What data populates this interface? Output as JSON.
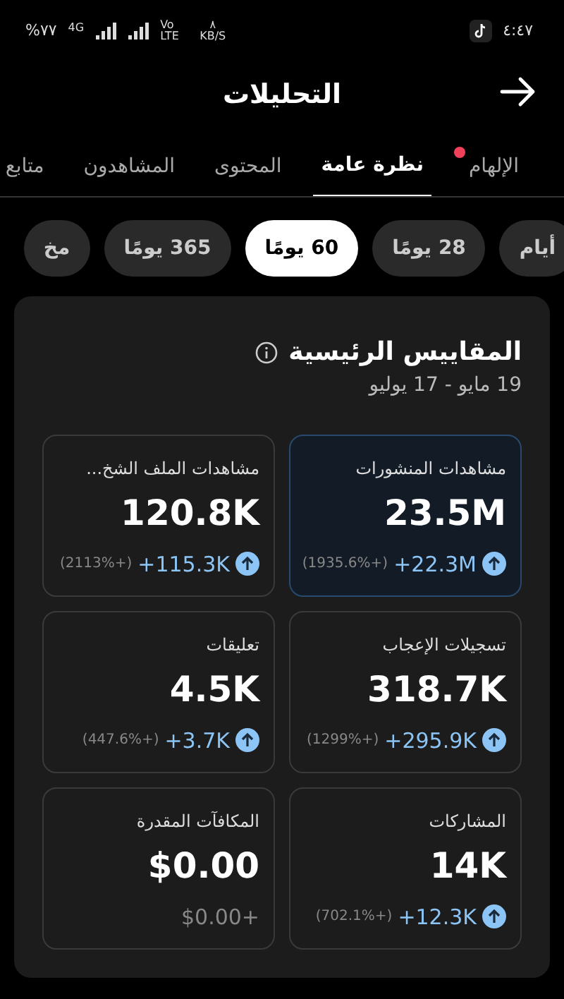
{
  "status_bar": {
    "time": "٤:٤٧",
    "battery": "%٧٧",
    "network": "4G",
    "volte": "Vo LTE",
    "speed_value": "٨",
    "speed_unit": "KB/S"
  },
  "header": {
    "title": "التحليلات"
  },
  "tabs": [
    {
      "label": "الإلهام",
      "selected": false,
      "dot": true
    },
    {
      "label": "نظرة عامة",
      "selected": true,
      "dot": false
    },
    {
      "label": "المحتوى",
      "selected": false,
      "dot": false
    },
    {
      "label": "المشاهدون",
      "selected": false,
      "dot": false
    },
    {
      "label": "متابع",
      "selected": false,
      "dot": false
    }
  ],
  "ranges": [
    {
      "label": "أيام",
      "selected": false
    },
    {
      "label": "28 يومًا",
      "selected": false
    },
    {
      "label": "60 يومًا",
      "selected": true
    },
    {
      "label": "365 يومًا",
      "selected": false
    },
    {
      "label": "مخ",
      "selected": false
    }
  ],
  "key_metrics": {
    "title": "المقاييس الرئيسية",
    "date_range": "19 مايو - 17 يوليو",
    "metrics": [
      {
        "label": "مشاهدات المنشورات",
        "value": "23.5M",
        "change": "+22.3M",
        "percent": "(1935.6%+)",
        "up": true,
        "selected": true
      },
      {
        "label": "مشاهدات الملف الشخ...",
        "value": "120.8K",
        "change": "+115.3K",
        "percent": "(2113%+)",
        "up": true,
        "selected": false
      },
      {
        "label": "تسجيلات الإعجاب",
        "value": "318.7K",
        "change": "+295.9K",
        "percent": "(1299%+)",
        "up": true,
        "selected": false
      },
      {
        "label": "تعليقات",
        "value": "4.5K",
        "change": "+3.7K",
        "percent": "(447.6%+)",
        "up": true,
        "selected": false
      },
      {
        "label": "المشاركات",
        "value": "14K",
        "change": "+12.3K",
        "percent": "(702.1%+)",
        "up": true,
        "selected": false
      },
      {
        "label": "المكافآت المقدرة",
        "value": "$0.00",
        "change": "$0.00+",
        "up": false,
        "selected": false
      }
    ]
  }
}
